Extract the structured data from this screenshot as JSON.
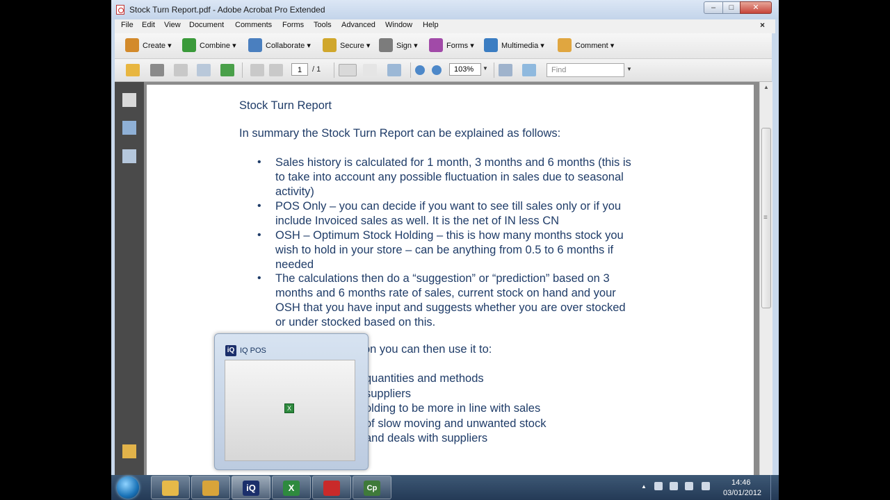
{
  "window": {
    "title": "Stock Turn Report.pdf - Adobe Acrobat Pro Extended",
    "min_label": "–",
    "max_label": "□",
    "close_label": "✕"
  },
  "menu": [
    "File",
    "Edit",
    "View",
    "Document",
    "Comments",
    "Forms",
    "Tools",
    "Advanced",
    "Window",
    "Help"
  ],
  "menu_close": "×",
  "task_buttons": [
    {
      "label": "Create ▾",
      "icon": "create-icon",
      "color": "#d38a2b"
    },
    {
      "label": "Combine ▾",
      "icon": "combine-icon",
      "color": "#3a9a3a"
    },
    {
      "label": "Collaborate ▾",
      "icon": "collaborate-icon",
      "color": "#4a7fbf"
    },
    {
      "label": "Secure ▾",
      "icon": "lock-icon",
      "color": "#d0a72c"
    },
    {
      "label": "Sign ▾",
      "icon": "pen-icon",
      "color": "#7c7c7c"
    },
    {
      "label": "Forms ▾",
      "icon": "forms-icon",
      "color": "#a14aa8"
    },
    {
      "label": "Multimedia ▾",
      "icon": "multimedia-icon",
      "color": "#3b7dc2"
    },
    {
      "label": "Comment ▾",
      "icon": "comment-icon",
      "color": "#e0a640"
    }
  ],
  "nav": {
    "page_current": "1",
    "page_total": "/ 1",
    "zoom": "103%",
    "find_placeholder": "Find"
  },
  "document": {
    "title": "Stock Turn Report",
    "intro": "In summary the Stock Turn Report can be explained as follows:",
    "bullets": [
      [
        "Sales history is calculated for 1 month, 3 months and 6 months (this is",
        "to take into account any possible fluctuation in sales due to seasonal",
        "activity)"
      ],
      [
        "POS Only – you can decide if you want to see till sales only or if you",
        "include Invoiced sales as well. It is the net of IN less CN"
      ],
      [
        "OSH – Optimum Stock Holding – this is how many months stock you",
        "wish to hold in your store – can be anything from 0.5 to 6 months if",
        "needed"
      ],
      [
        "The calculations then do a “suggestion” or “prediction” based on 3",
        "months and 6 months rate of sales, current stock on hand and your",
        "OSH that you have input and suggests whether you are over stocked",
        "or under stocked based on this."
      ]
    ],
    "partial_intro": "on you can then use it to:",
    "partial_lines": [
      "quantities and methods",
      "suppliers",
      "olding to be more in line with sales",
      "of slow moving and unwanted stock",
      "and deals with suppliers"
    ]
  },
  "thumbnail": {
    "title": "IQ POS",
    "logo": "iQ"
  },
  "taskbar": {
    "items": [
      {
        "icon": "explorer-icon",
        "text": "",
        "color": "#e6b949"
      },
      {
        "icon": "outlook-icon",
        "text": "",
        "color": "#d8a43a"
      },
      {
        "icon": "iq-pos-icon",
        "text": "iQ",
        "color": "#1b2f6b"
      },
      {
        "icon": "excel-icon",
        "text": "X",
        "color": "#2e8a3e"
      },
      {
        "icon": "acrobat-icon",
        "text": "",
        "color": "#c92a2a"
      },
      {
        "icon": "captivate-icon",
        "text": "Cp",
        "color": "#3f7a3a"
      }
    ],
    "time": "14:46",
    "date": "03/01/2012",
    "tray_arrow": "▲"
  }
}
